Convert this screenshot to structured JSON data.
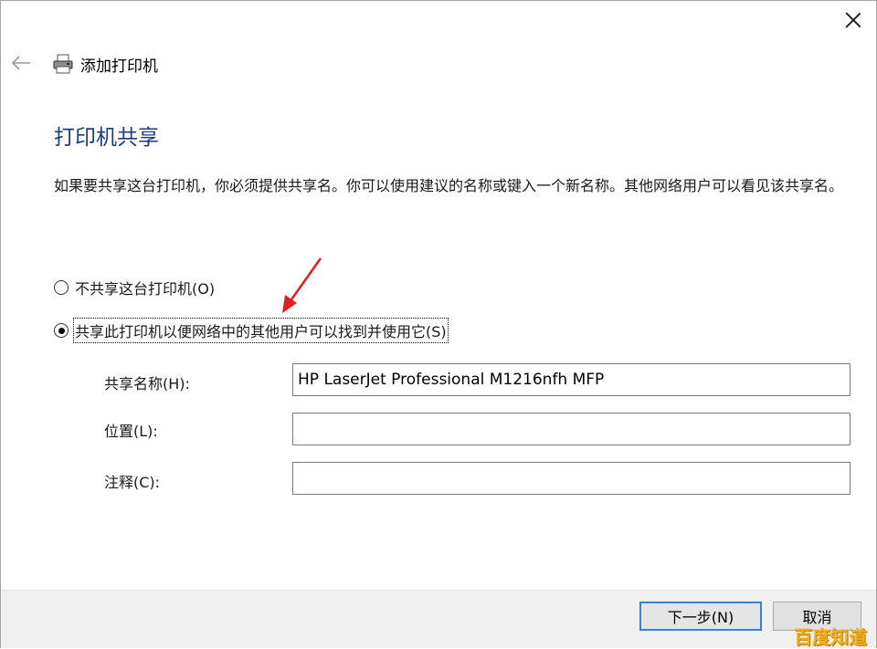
{
  "window": {
    "title": "添加打印机"
  },
  "page": {
    "title": "打印机共享",
    "description": "如果要共享这台打印机，你必须提供共享名。你可以使用建议的名称或键入一个新名称。其他网络用户可以看见该共享名。"
  },
  "sharing_options": [
    {
      "label": "不共享这台打印机(O)",
      "selected": false
    },
    {
      "label": "共享此打印机以便网络中的其他用户可以找到并使用它(S)",
      "selected": true
    }
  ],
  "fields": {
    "share_name": {
      "label": "共享名称(H):",
      "value": "HP LaserJet Professional M1216nfh MFP"
    },
    "location": {
      "label": "位置(L):",
      "value": ""
    },
    "comment": {
      "label": "注释(C):",
      "value": ""
    }
  },
  "buttons": {
    "next": "下一步(N)",
    "cancel": "取消"
  },
  "watermark": "百度知道",
  "colors": {
    "title_blue": "#1c3c82",
    "annotation_red": "#e02020",
    "default_button_border": "#3c7fd4"
  },
  "icons": {
    "back": "back-arrow-icon",
    "printer": "printer-icon",
    "close": "close-icon"
  }
}
